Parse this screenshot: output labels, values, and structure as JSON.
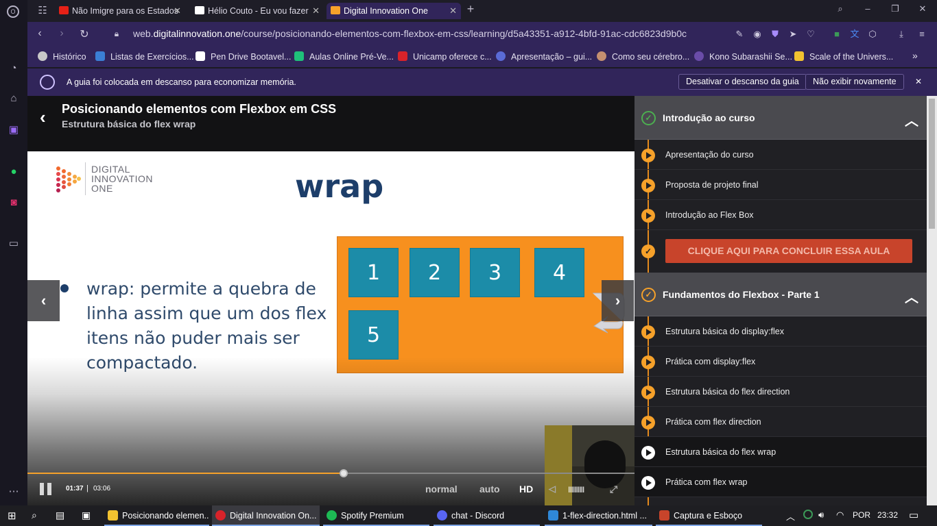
{
  "browser": {
    "tabs": [
      {
        "title": "Não Imigre para os Estados",
        "favicon_color": "#e62117"
      },
      {
        "title": "Hélio Couto - Eu vou fazer",
        "favicon_color": "#ffffff"
      },
      {
        "title": "Digital Innovation One",
        "favicon_color": "#f6a12a",
        "active": true
      }
    ],
    "url_prefix": "web.",
    "url_domain": "digitalinnovation.one",
    "url_path": "/course/posicionando-elementos-com-flexbox-em-css/learning/d5a43351-a912-4bfd-91ac-cdc6823d9b0c",
    "bookmarks": [
      {
        "label": "Histórico",
        "color": "#c8c8c8"
      },
      {
        "label": "Listas de Exercícios...",
        "color": "#3b7fd4"
      },
      {
        "label": "Pen Drive Bootavel...",
        "color": "#ffffff"
      },
      {
        "label": "Aulas Online Pré-Ve...",
        "color": "#1fbf7a"
      },
      {
        "label": "Unicamp oferece c...",
        "color": "#d8232a"
      },
      {
        "label": "Apresentação – gui...",
        "color": "#5a6bd6"
      },
      {
        "label": "Como seu cérebro...",
        "color": "#c49070"
      },
      {
        "label": "Kono Subarashii Se...",
        "color": "#6a4ca8"
      },
      {
        "label": "Scale of the Univers...",
        "color": "#f2c230"
      }
    ],
    "notification": {
      "message": "A guia foi colocada em descanso para economizar memória.",
      "btn_disable": "Desativar o descanso da guia",
      "btn_never": "Não exibir novamente"
    }
  },
  "lesson": {
    "title": "Posicionando elementos com Flexbox em CSS",
    "subtitle": "Estrutura básica do flex wrap"
  },
  "slide": {
    "logo_line1": "DIGITAL",
    "logo_line2": "INNOVATION",
    "logo_line3": "ONE",
    "heading": "wrap",
    "bullet": "wrap: permite a quebra de linha assim que um dos flex itens não puder mais ser compactado.",
    "items": [
      "1",
      "2",
      "3",
      "4",
      "5"
    ]
  },
  "player": {
    "time_current": "01:37",
    "time_sep": "|",
    "time_total": "03:06",
    "progress": 0.521,
    "speed_label": "normal",
    "quality_auto": "auto",
    "quality_hd": "HD",
    "volume_bars": "IIIIIIIIII"
  },
  "course": {
    "section1": {
      "title": "Introdução ao curso",
      "items": [
        "Apresentação do curso",
        "Proposta de projeto final",
        "Introdução ao Flex Box"
      ],
      "conclude": "CLIQUE AQUI PARA CONCLUIR ESSA AULA"
    },
    "section2": {
      "title": "Fundamentos do Flexbox - Parte 1",
      "items": [
        "Estrutura básica do display:flex",
        "Prática com display:flex",
        "Estrutura básica do flex direction",
        "Prática com flex direction",
        "Estrutura básica do flex wrap",
        "Prática com flex wrap"
      ]
    }
  },
  "taskbar": {
    "items": [
      {
        "label": "Posicionando elemen...",
        "color": "#f2c230"
      },
      {
        "label": "Digital Innovation On...",
        "color": "#d8232a"
      },
      {
        "label": "Spotify Premium",
        "color": "#1db954"
      },
      {
        "label": "chat - Discord",
        "color": "#5865f2"
      },
      {
        "label": "1-flex-direction.html ...",
        "color": "#2f88d8"
      },
      {
        "label": "Captura e Esboço",
        "color": "#c8442b"
      }
    ],
    "lang": "POR",
    "clock": "23:32"
  }
}
